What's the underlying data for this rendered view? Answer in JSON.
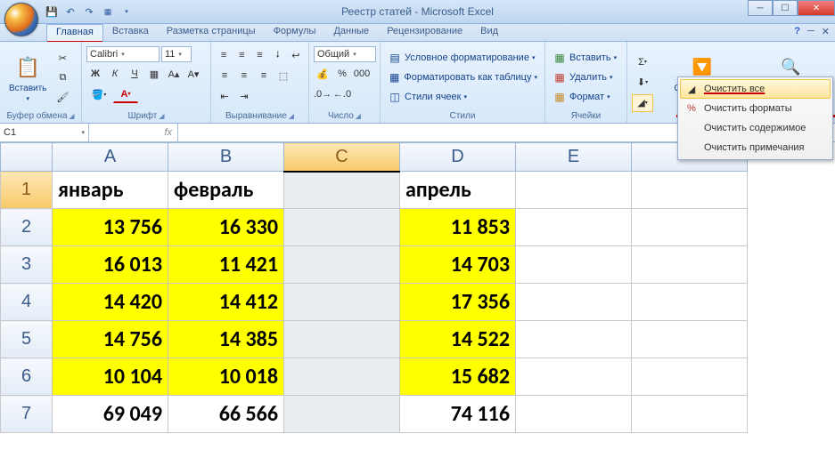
{
  "title": "Реестр статей - Microsoft Excel",
  "tabs": {
    "home": "Главная",
    "insert": "Вставка",
    "layout": "Разметка страницы",
    "formulas": "Формулы",
    "data": "Данные",
    "review": "Рецензирование",
    "view": "Вид"
  },
  "ribbon": {
    "clipboard": {
      "paste": "Вставить",
      "label": "Буфер обмена"
    },
    "font": {
      "name": "Calibri",
      "size": "11",
      "label": "Шрифт"
    },
    "alignment": {
      "label": "Выравнивание"
    },
    "number": {
      "format": "Общий",
      "label": "Число"
    },
    "styles": {
      "conditional": "Условное форматирование",
      "table": "Форматировать как таблицу",
      "cell": "Стили ячеек",
      "label": "Стили"
    },
    "cells": {
      "insert": "Вставить",
      "delete": "Удалить",
      "format": "Формат",
      "label": "Ячейки"
    },
    "editing": {
      "sort": "Сортировка и фильтр",
      "find": "Найти и выделить"
    }
  },
  "clear_menu": {
    "all": "Очистить все",
    "formats": "Очистить форматы",
    "contents": "Очистить содержимое",
    "comments": "Очистить примечания"
  },
  "formula_bar": {
    "cell_ref": "C1"
  },
  "grid": {
    "columns": [
      "A",
      "B",
      "C",
      "D",
      "E"
    ],
    "rows": [
      "1",
      "2",
      "3",
      "4",
      "5",
      "6",
      "7"
    ],
    "headers": {
      "a": "январь",
      "b": "февраль",
      "d": "апрель"
    },
    "data": {
      "r2": {
        "a": "13 756",
        "b": "16 330",
        "d": "11 853"
      },
      "r3": {
        "a": "16 013",
        "b": "11 421",
        "d": "14 703"
      },
      "r4": {
        "a": "14 420",
        "b": "14 412",
        "d": "17 356"
      },
      "r5": {
        "a": "14 756",
        "b": "14 385",
        "d": "14 522"
      },
      "r6": {
        "a": "10 104",
        "b": "10 018",
        "d": "15 682"
      }
    },
    "totals": {
      "a": "69 049",
      "b": "66 566",
      "d": "74 116"
    }
  },
  "chart_data": {
    "type": "table",
    "categories": [
      "январь",
      "февраль",
      "апрель"
    ],
    "rows": [
      [
        13756,
        16330,
        11853
      ],
      [
        16013,
        11421,
        14703
      ],
      [
        14420,
        14412,
        17356
      ],
      [
        14756,
        14385,
        14522
      ],
      [
        10104,
        10018,
        15682
      ]
    ],
    "totals": [
      69049,
      66566,
      74116
    ]
  }
}
